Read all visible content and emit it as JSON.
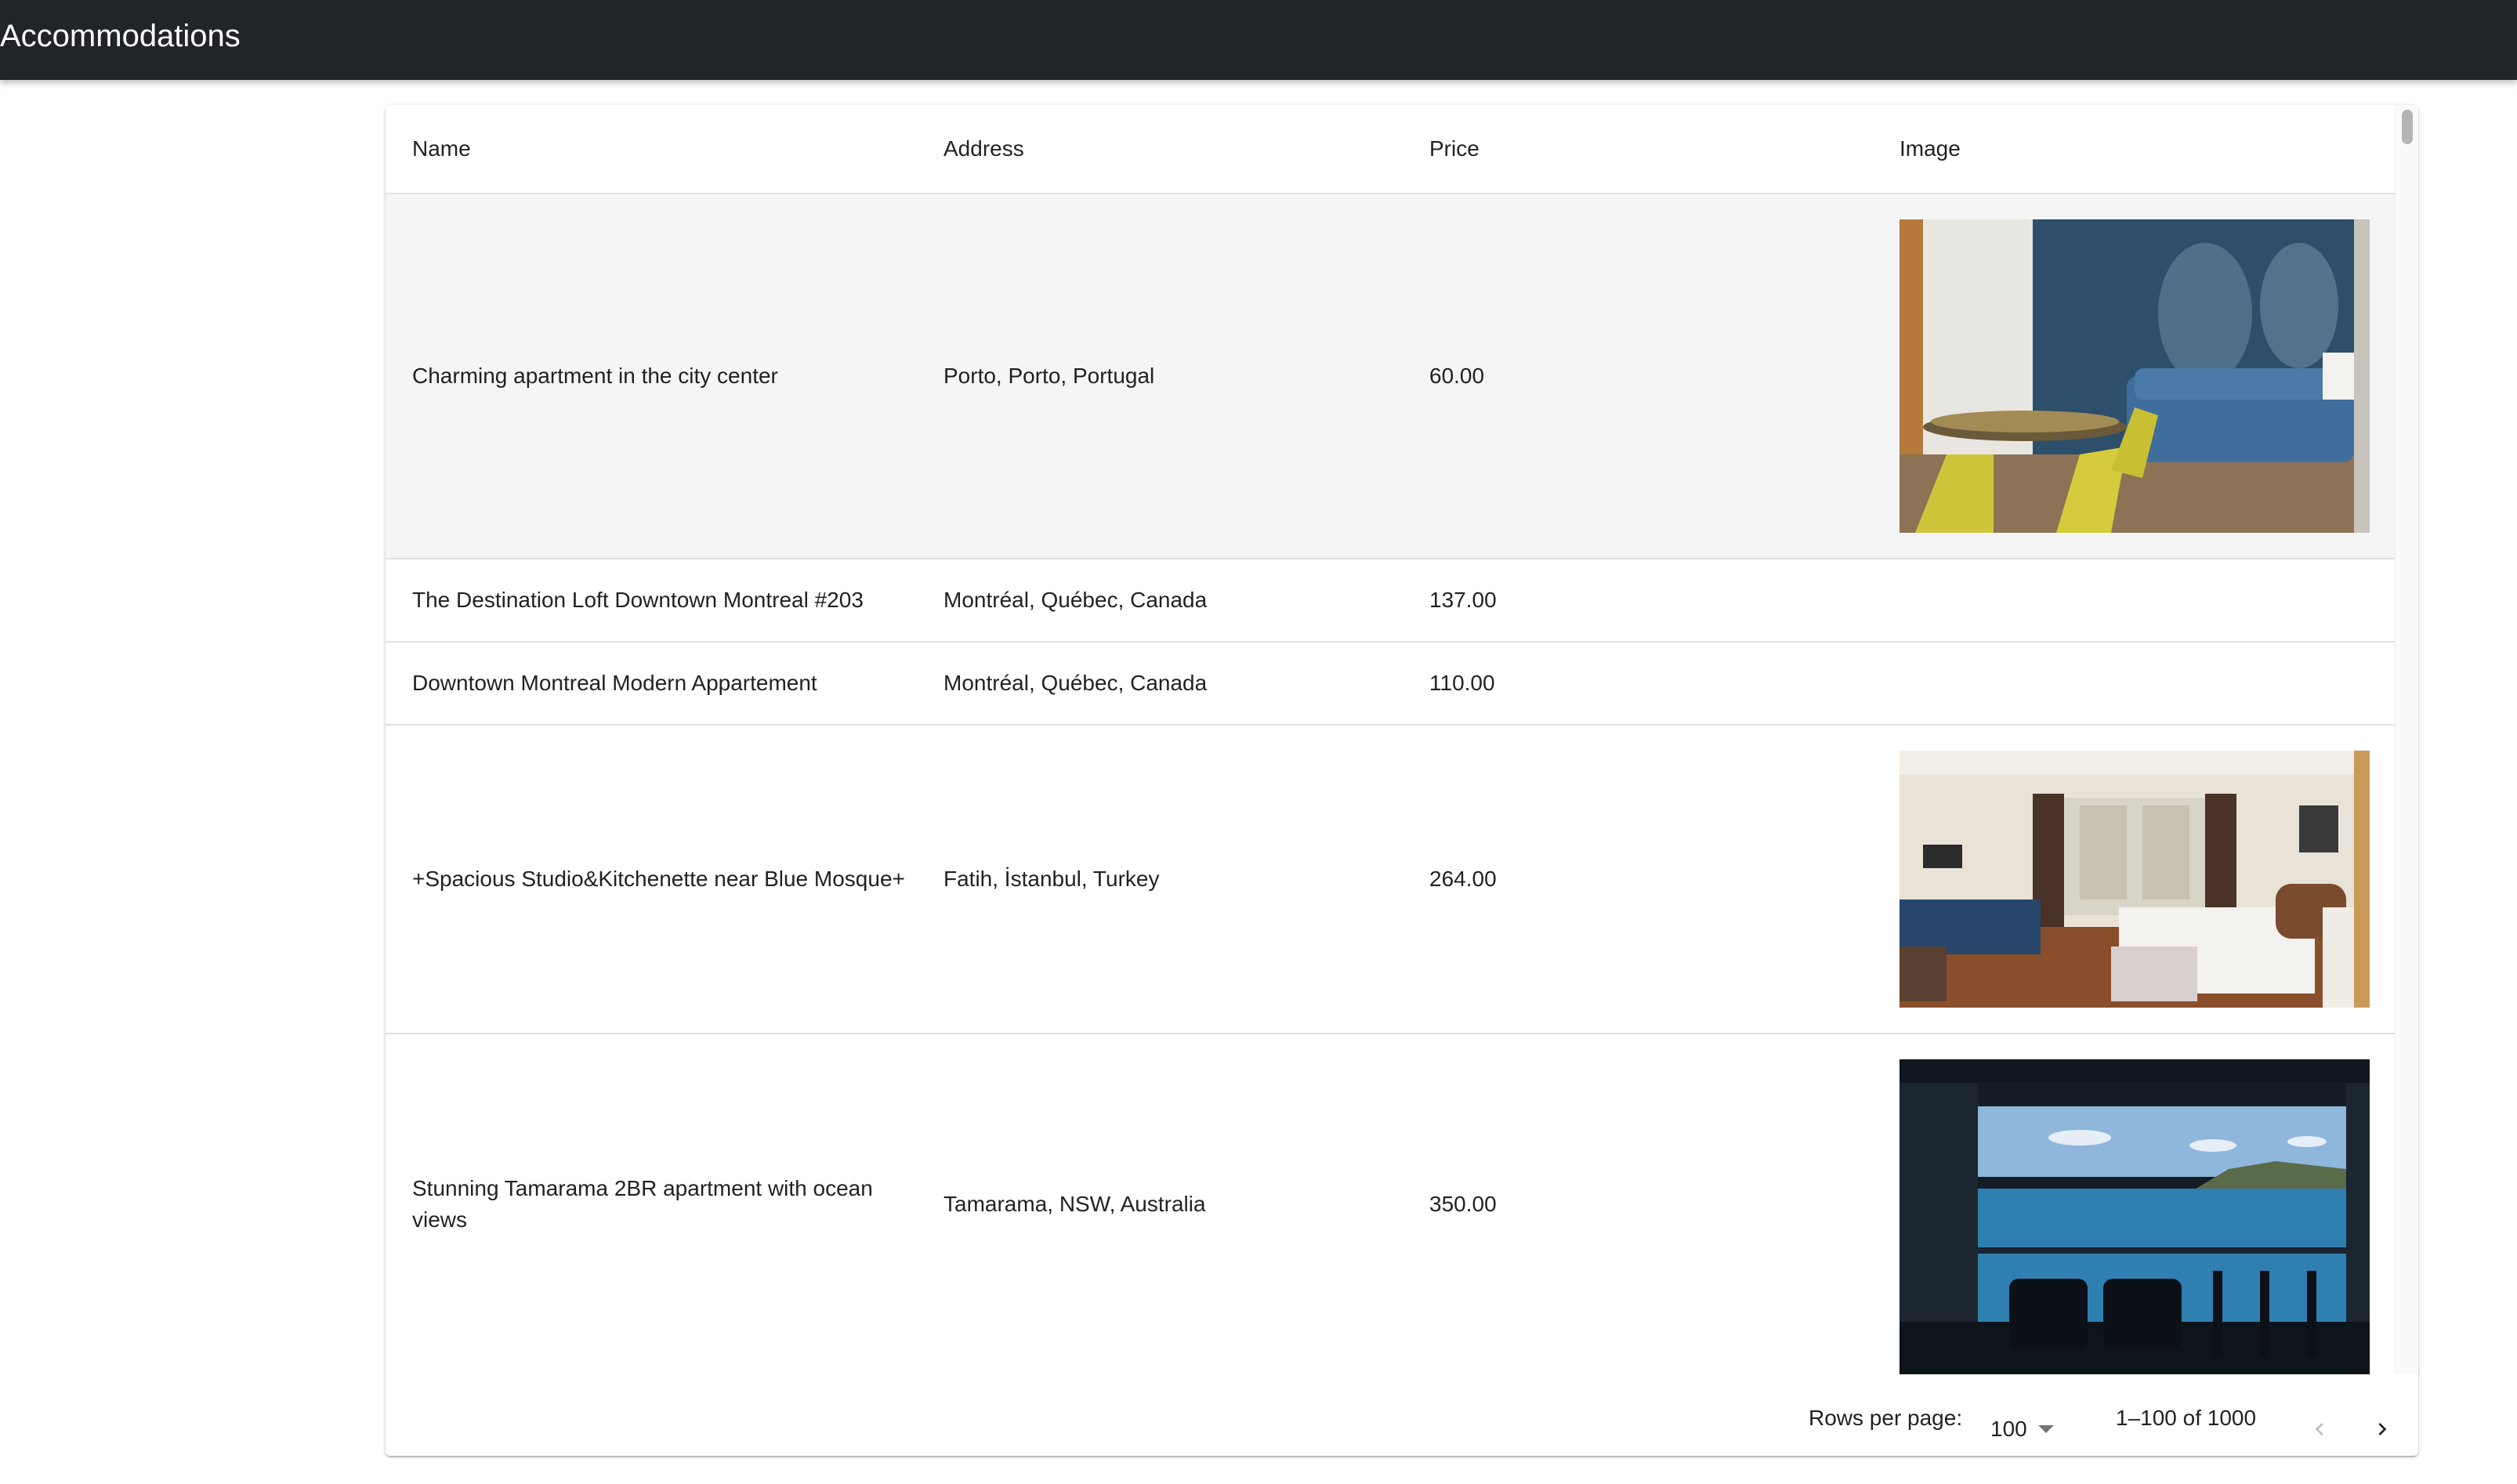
{
  "appbar": {
    "title": "Accommodations"
  },
  "table": {
    "columns": [
      "Name",
      "Address",
      "Price",
      "Image"
    ],
    "rows": [
      {
        "name": "Charming apartment in the city center",
        "address": "Porto, Porto, Portugal",
        "price": "60.00",
        "image": "living-room-blue-sofa-yellow-chairs"
      },
      {
        "name": "The Destination Loft Downtown Montreal #203",
        "address": "Montréal, Québec, Canada",
        "price": "137.00",
        "image": ""
      },
      {
        "name": "Downtown Montreal Modern Appartement",
        "address": "Montréal, Québec, Canada",
        "price": "110.00",
        "image": ""
      },
      {
        "name": "+Spacious Studio&Kitchenette near Blue Mosque+",
        "address": "Fatih, İstanbul, Turkey",
        "price": "264.00",
        "image": "studio-bedroom-with-sofa"
      },
      {
        "name": "Stunning Tamarama 2BR apartment with ocean views",
        "address": "Tamarama, NSW, Australia",
        "price": "350.00",
        "image": "balcony-ocean-view"
      }
    ]
  },
  "pagination": {
    "rows_per_page_label": "Rows per page:",
    "rows_per_page_value": "100",
    "range_label": "1–100 of 1000",
    "prev_icon": "chevron-left-icon",
    "next_icon": "chevron-right-icon"
  },
  "colors": {
    "appbar_bg": "#212529",
    "row_highlight": "#f5f5f5",
    "divider": "#e0e0e0"
  }
}
